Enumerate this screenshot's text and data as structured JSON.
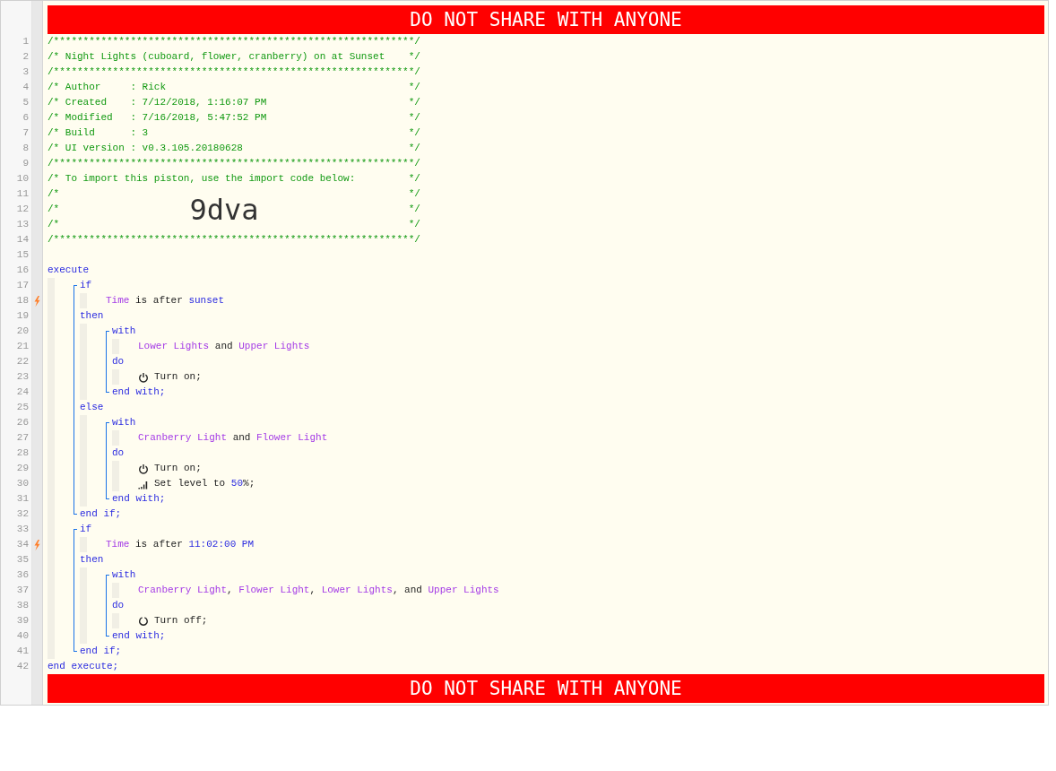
{
  "banner_top": "DO NOT SHARE WITH ANYONE",
  "header": [
    {
      "number": "1",
      "text": "/*************************************************************/"
    },
    {
      "number": "2",
      "text": "/* Night Lights (cuboard, flower, cranberry) on at Sunset",
      "close": "*/"
    },
    {
      "number": "3",
      "text": "/*************************************************************/"
    },
    {
      "number": "4",
      "text": "/* Author     : Rick",
      "close": "*/"
    },
    {
      "number": "5",
      "text": "/* Created    : 7/12/2018, 1:16:07 PM",
      "close": "*/"
    },
    {
      "number": "6",
      "text": "/* Modified   : 7/16/2018, 5:47:52 PM",
      "close": "*/"
    },
    {
      "number": "7",
      "text": "/* Build      : 3",
      "close": "*/"
    },
    {
      "number": "8",
      "text": "/* UI version : v0.3.105.20180628",
      "close": "*/"
    },
    {
      "number": "9",
      "text": "/*************************************************************/"
    },
    {
      "number": "10",
      "text": "/* To import this piston, use the import code below:",
      "close": "*/"
    },
    {
      "number": "11",
      "text": "/*",
      "close": "*/"
    },
    {
      "number": "12",
      "text": "/*",
      "code": "9dva",
      "close": "*/"
    },
    {
      "number": "13",
      "text": "/*",
      "close": "*/"
    },
    {
      "number": "14",
      "text": "/*************************************************************/"
    },
    {
      "number": "15"
    }
  ],
  "program": [
    {
      "kind": "line",
      "number": "16",
      "trigger": false,
      "tokens": [
        {
          "kind": "keyword",
          "text": "execute"
        }
      ]
    },
    {
      "kind": "body",
      "children": [
        {
          "kind": "block",
          "children": [
            {
              "kind": "line",
              "number": "17",
              "trigger": false,
              "tokens": [
                {
                  "kind": "keyword",
                  "text": "if"
                }
              ]
            },
            {
              "kind": "body",
              "children": [
                {
                  "kind": "line",
                  "number": "18",
                  "trigger": true,
                  "tokens": [
                    {
                      "kind": "device",
                      "text": "Time"
                    },
                    {
                      "kind": "text",
                      "text": " is after "
                    },
                    {
                      "kind": "value",
                      "text": "sunset"
                    }
                  ]
                }
              ]
            },
            {
              "kind": "line",
              "number": "19",
              "trigger": false,
              "tokens": [
                {
                  "kind": "keyword",
                  "text": "then"
                }
              ]
            },
            {
              "kind": "body",
              "children": [
                {
                  "kind": "block",
                  "children": [
                    {
                      "kind": "line",
                      "number": "20",
                      "trigger": false,
                      "tokens": [
                        {
                          "kind": "keyword",
                          "text": "with"
                        }
                      ]
                    },
                    {
                      "kind": "body",
                      "children": [
                        {
                          "kind": "line",
                          "number": "21",
                          "trigger": false,
                          "tokens": [
                            {
                              "kind": "device",
                              "text": "Lower Lights"
                            },
                            {
                              "kind": "text",
                              "text": " and "
                            },
                            {
                              "kind": "device",
                              "text": "Upper Lights"
                            }
                          ]
                        }
                      ]
                    },
                    {
                      "kind": "line",
                      "number": "22",
                      "trigger": false,
                      "tokens": [
                        {
                          "kind": "keyword",
                          "text": "do"
                        }
                      ]
                    },
                    {
                      "kind": "body",
                      "children": [
                        {
                          "kind": "line",
                          "number": "23",
                          "trigger": false,
                          "tokens": [
                            {
                              "kind": "on"
                            },
                            {
                              "kind": "text",
                              "text": "Turn on;"
                            }
                          ]
                        }
                      ]
                    },
                    {
                      "kind": "line",
                      "number": "24",
                      "trigger": false,
                      "tokens": [
                        {
                          "kind": "keyword",
                          "text": "end with;"
                        }
                      ]
                    }
                  ]
                }
              ]
            },
            {
              "kind": "line",
              "number": "25",
              "trigger": false,
              "tokens": [
                {
                  "kind": "keyword",
                  "text": "else"
                }
              ]
            },
            {
              "kind": "body",
              "children": [
                {
                  "kind": "block",
                  "children": [
                    {
                      "kind": "line",
                      "number": "26",
                      "trigger": false,
                      "tokens": [
                        {
                          "kind": "keyword",
                          "text": "with"
                        }
                      ]
                    },
                    {
                      "kind": "body",
                      "children": [
                        {
                          "kind": "line",
                          "number": "27",
                          "trigger": false,
                          "tokens": [
                            {
                              "kind": "device",
                              "text": "Cranberry Light"
                            },
                            {
                              "kind": "text",
                              "text": " and "
                            },
                            {
                              "kind": "device",
                              "text": "Flower Light"
                            }
                          ]
                        }
                      ]
                    },
                    {
                      "kind": "line",
                      "number": "28",
                      "trigger": false,
                      "tokens": [
                        {
                          "kind": "keyword",
                          "text": "do"
                        }
                      ]
                    },
                    {
                      "kind": "body",
                      "children": [
                        {
                          "kind": "line",
                          "number": "29",
                          "trigger": false,
                          "tokens": [
                            {
                              "kind": "on"
                            },
                            {
                              "kind": "text",
                              "text": "Turn on;"
                            }
                          ]
                        },
                        {
                          "kind": "line",
                          "number": "30",
                          "trigger": false,
                          "tokens": [
                            {
                              "kind": "level"
                            },
                            {
                              "kind": "text",
                              "text": "Set level to "
                            },
                            {
                              "kind": "value",
                              "text": "50"
                            },
                            {
                              "kind": "text",
                              "text": "%;"
                            }
                          ]
                        }
                      ]
                    },
                    {
                      "kind": "line",
                      "number": "31",
                      "trigger": false,
                      "tokens": [
                        {
                          "kind": "keyword",
                          "text": "end with;"
                        }
                      ]
                    }
                  ]
                }
              ]
            },
            {
              "kind": "line",
              "number": "32",
              "trigger": false,
              "tokens": [
                {
                  "kind": "keyword",
                  "text": "end if;"
                }
              ]
            }
          ]
        },
        {
          "kind": "block",
          "children": [
            {
              "kind": "line",
              "number": "33",
              "trigger": false,
              "tokens": [
                {
                  "kind": "keyword",
                  "text": "if"
                }
              ]
            },
            {
              "kind": "body",
              "children": [
                {
                  "kind": "line",
                  "number": "34",
                  "trigger": true,
                  "tokens": [
                    {
                      "kind": "device",
                      "text": "Time"
                    },
                    {
                      "kind": "text",
                      "text": " is after "
                    },
                    {
                      "kind": "value",
                      "text": "11:02:00 PM"
                    }
                  ]
                }
              ]
            },
            {
              "kind": "line",
              "number": "35",
              "trigger": false,
              "tokens": [
                {
                  "kind": "keyword",
                  "text": "then"
                }
              ]
            },
            {
              "kind": "body",
              "children": [
                {
                  "kind": "block",
                  "children": [
                    {
                      "kind": "line",
                      "number": "36",
                      "trigger": false,
                      "tokens": [
                        {
                          "kind": "keyword",
                          "text": "with"
                        }
                      ]
                    },
                    {
                      "kind": "body",
                      "children": [
                        {
                          "kind": "line",
                          "number": "37",
                          "trigger": false,
                          "tokens": [
                            {
                              "kind": "device",
                              "text": "Cranberry Light"
                            },
                            {
                              "kind": "text",
                              "text": ", "
                            },
                            {
                              "kind": "device",
                              "text": "Flower Light"
                            },
                            {
                              "kind": "text",
                              "text": ", "
                            },
                            {
                              "kind": "device",
                              "text": "Lower Lights"
                            },
                            {
                              "kind": "text",
                              "text": ", and "
                            },
                            {
                              "kind": "device",
                              "text": "Upper Lights"
                            }
                          ]
                        }
                      ]
                    },
                    {
                      "kind": "line",
                      "number": "38",
                      "trigger": false,
                      "tokens": [
                        {
                          "kind": "keyword",
                          "text": "do"
                        }
                      ]
                    },
                    {
                      "kind": "body",
                      "children": [
                        {
                          "kind": "line",
                          "number": "39",
                          "trigger": false,
                          "tokens": [
                            {
                              "kind": "off"
                            },
                            {
                              "kind": "text",
                              "text": "Turn off;"
                            }
                          ]
                        }
                      ]
                    },
                    {
                      "kind": "line",
                      "number": "40",
                      "trigger": false,
                      "tokens": [
                        {
                          "kind": "keyword",
                          "text": "end with;"
                        }
                      ]
                    }
                  ]
                }
              ]
            },
            {
              "kind": "line",
              "number": "41",
              "trigger": false,
              "tokens": [
                {
                  "kind": "keyword",
                  "text": "end if;"
                }
              ]
            }
          ]
        }
      ]
    },
    {
      "kind": "line",
      "number": "42",
      "trigger": false,
      "tokens": [
        {
          "kind": "keyword",
          "text": "end execute;"
        }
      ]
    }
  ],
  "banner_bottom": "DO NOT SHARE WITH ANYONE"
}
